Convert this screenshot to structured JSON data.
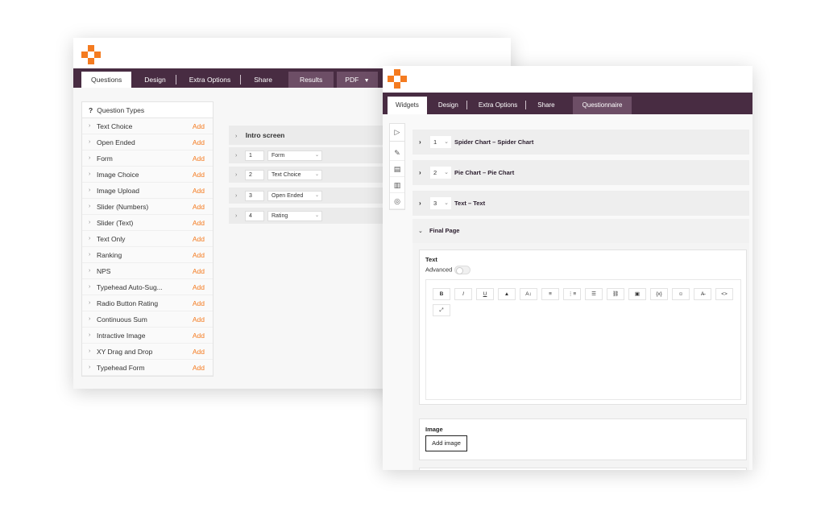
{
  "back": {
    "tabs": [
      {
        "label": "Questions"
      },
      {
        "label": "Design"
      },
      {
        "label": "Extra Options"
      },
      {
        "label": "Share"
      },
      {
        "label": "Results"
      },
      {
        "label": "PDF"
      }
    ],
    "question_types": {
      "header_icon": "?",
      "header": "Question Types",
      "add_label": "Add",
      "items": [
        "Text Choice",
        "Open Ended",
        "Form",
        "Image Choice",
        "Image Upload",
        "Slider (Numbers)",
        "Slider (Text)",
        "Text Only",
        "Ranking",
        "NPS",
        "Typehead Auto-Sug...",
        "Radio Button Rating",
        "Continuous Sum",
        "Intractive Image",
        "XY Drag and Drop",
        "Typehead Form"
      ]
    },
    "intro_title": "Intro screen",
    "questions": [
      {
        "num": "1",
        "type": "Form"
      },
      {
        "num": "2",
        "type": "Text Choice"
      },
      {
        "num": "3",
        "type": "Open Ended"
      },
      {
        "num": "4",
        "type": "Rating"
      }
    ]
  },
  "front": {
    "tabs": [
      {
        "label": "Widgets"
      },
      {
        "label": "Design"
      },
      {
        "label": "Extra Options"
      },
      {
        "label": "Share"
      },
      {
        "label": "Questionnaire"
      }
    ],
    "widgets": [
      {
        "num": "1",
        "name": "Spider Chart  –  Spider Chart"
      },
      {
        "num": "2",
        "name": "Pie Chart  –  Pie Chart"
      },
      {
        "num": "3",
        "name": "Text  –  Text"
      }
    ],
    "final_page": "Final Page",
    "text_card": {
      "title": "Text",
      "advanced": "Advanced"
    },
    "toolbar": [
      "B",
      "I",
      "U",
      "▲",
      "A↕",
      "≡",
      "⋮≡",
      "☰",
      "⛓",
      "▣",
      "{x}",
      "☺",
      "A̶",
      "<>",
      "⤢"
    ],
    "image_card": {
      "title": "Image",
      "button": "Add image"
    }
  }
}
